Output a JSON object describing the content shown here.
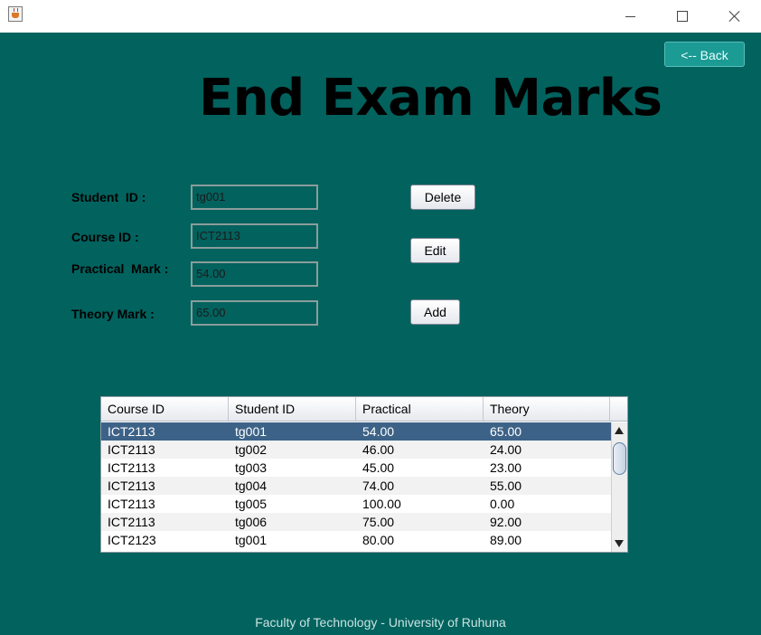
{
  "window": {
    "icon": "java-cup-icon",
    "controls": [
      "minimize-icon",
      "maximize-icon",
      "close-icon"
    ]
  },
  "header": {
    "back_label": "<-- Back",
    "title": "End Exam Marks"
  },
  "form": {
    "student_id": {
      "label": "Student  ID :",
      "value": "tg001"
    },
    "course_id": {
      "label": "Course ID :",
      "value": "ICT2113"
    },
    "practical_mark": {
      "label": "Practical  Mark :",
      "value": "54.00"
    },
    "theory_mark": {
      "label": "Theory Mark :",
      "value": "65.00"
    }
  },
  "actions": {
    "delete_label": "Delete",
    "edit_label": "Edit",
    "add_label": "Add"
  },
  "table": {
    "columns": [
      "Course ID",
      "Student ID",
      "Practical",
      "Theory"
    ],
    "selected_row": 0,
    "rows": [
      [
        "ICT2113",
        "tg001",
        "54.00",
        "65.00"
      ],
      [
        "ICT2113",
        "tg002",
        "46.00",
        "24.00"
      ],
      [
        "ICT2113",
        "tg003",
        "45.00",
        "23.00"
      ],
      [
        "ICT2113",
        "tg004",
        "74.00",
        "55.00"
      ],
      [
        "ICT2113",
        "tg005",
        "100.00",
        "0.00"
      ],
      [
        "ICT2113",
        "tg006",
        "75.00",
        "92.00"
      ],
      [
        "ICT2123",
        "tg001",
        "80.00",
        "89.00"
      ]
    ]
  },
  "footer": {
    "text": "Faculty of Technology - University of Ruhuna"
  },
  "colors": {
    "background": "#02625e",
    "back_button": "#1c9a94",
    "selected_row": "#3d6287"
  }
}
